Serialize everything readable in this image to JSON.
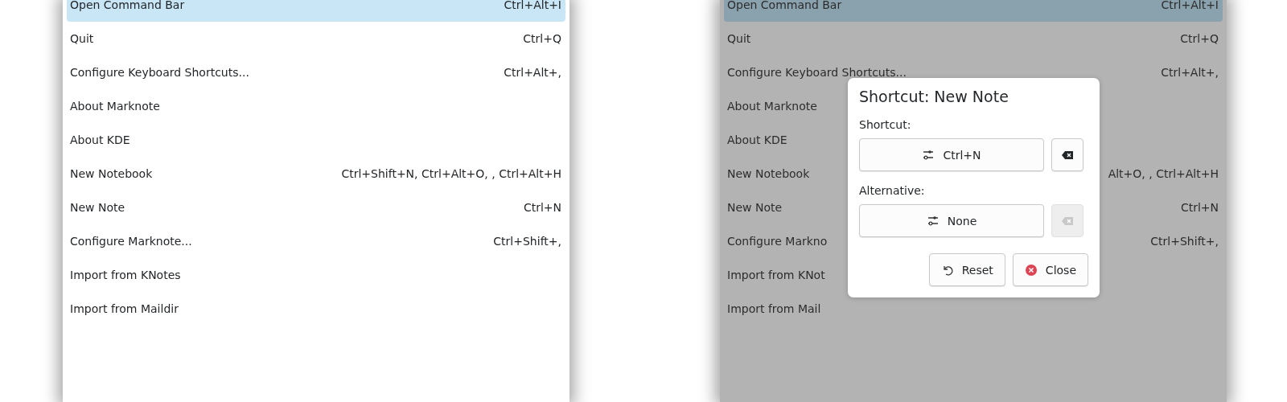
{
  "menu_panels": [
    {
      "dimmed": false,
      "items": [
        {
          "label": "Open Command Bar",
          "shortcut": "Ctrl+Alt+I",
          "selected": true
        },
        {
          "label": "Quit",
          "shortcut": "Ctrl+Q",
          "selected": false
        },
        {
          "label": "Configure Keyboard Shortcuts...",
          "shortcut": "Ctrl+Alt+,",
          "selected": false
        },
        {
          "label": "About Marknote",
          "selected": false
        },
        {
          "label": "About KDE",
          "selected": false
        },
        {
          "label": "New Notebook",
          "shortcut": "Ctrl+Shift+N, Ctrl+Alt+O, , Ctrl+Alt+H",
          "selected": false
        },
        {
          "label": "New Note",
          "shortcut": "Ctrl+N",
          "selected": false
        },
        {
          "label": "Configure Marknote...",
          "shortcut": "Ctrl+Shift+,",
          "selected": false
        },
        {
          "label": "Import from KNotes",
          "selected": false
        },
        {
          "label": "Import from Maildir",
          "selected": false
        }
      ]
    },
    {
      "dimmed": true,
      "items": [
        {
          "label": "Open Command Bar",
          "shortcut": "Ctrl+Alt+I",
          "selected": true
        },
        {
          "label": "Quit",
          "shortcut": "Ctrl+Q",
          "selected": false
        },
        {
          "label": "Configure Keyboard Shortcuts...",
          "shortcut": "Ctrl+Alt+,",
          "selected": false
        },
        {
          "label": "About Marknote",
          "selected": false
        },
        {
          "label": "About KDE",
          "selected": false
        },
        {
          "label": "New Notebook",
          "shortcut": "Alt+O, , Ctrl+Alt+H",
          "selected": false
        },
        {
          "label": "New Note",
          "shortcut": "Ctrl+N",
          "selected": false
        },
        {
          "label": "Configure Markno",
          "shortcut": "Ctrl+Shift+,",
          "selected": false
        },
        {
          "label": "Import from KNot",
          "selected": false
        },
        {
          "label": "Import from Mail",
          "selected": false
        }
      ]
    }
  ],
  "dialog": {
    "title": "Shortcut: New Note",
    "fields": [
      {
        "label": "Shortcut:",
        "value": "Ctrl+N",
        "clear_disabled": false
      },
      {
        "label": "Alternative:",
        "value": "None",
        "clear_disabled": true
      }
    ],
    "buttons": [
      {
        "kind": "reset",
        "label": "Reset"
      },
      {
        "kind": "close",
        "label": "Close"
      }
    ]
  }
}
